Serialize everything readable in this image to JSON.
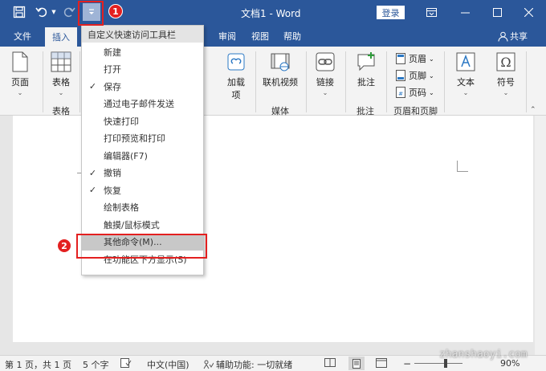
{
  "titlebar": {
    "title": "文档1 - Word",
    "login": "登录",
    "accent": "#2b579a"
  },
  "tabs": {
    "file": "文件",
    "insert": "插入",
    "review": "审阅",
    "view": "视图",
    "help": "帮助",
    "share": "共享"
  },
  "ribbon": {
    "page": "页面",
    "table": "表格",
    "table_group": "表格",
    "addins": "加载\n项",
    "addins_l1": "加载",
    "addins_l2": "项",
    "online_video": "联机视频",
    "media_group": "媒体",
    "link": "链接",
    "comment": "批注",
    "comment_group": "批注",
    "header": "页眉",
    "footer": "页脚",
    "page_number": "页码",
    "header_footer_group": "页眉和页脚",
    "text": "文本",
    "symbol": "符号"
  },
  "menu": {
    "title": "自定义快速访问工具栏",
    "items": [
      {
        "label": "新建",
        "checked": false
      },
      {
        "label": "打开",
        "checked": false
      },
      {
        "label": "保存",
        "checked": true
      },
      {
        "label": "通过电子邮件发送",
        "checked": false
      },
      {
        "label": "快速打印",
        "checked": false
      },
      {
        "label": "打印预览和打印",
        "checked": false
      },
      {
        "label": "编辑器(F7)",
        "checked": false
      },
      {
        "label": "撤销",
        "checked": true
      },
      {
        "label": "恢复",
        "checked": true
      },
      {
        "label": "绘制表格",
        "checked": false
      },
      {
        "label": "触摸/鼠标模式",
        "checked": false
      },
      {
        "label": "其他命令(M)...",
        "checked": false
      },
      {
        "label": "在功能区下方显示(S)",
        "checked": false
      }
    ],
    "check_mark": "✓"
  },
  "annotations": {
    "badge1": "1",
    "badge2": "2",
    "color": "#e32020"
  },
  "statusbar": {
    "page": "第 1 页，共 1 页",
    "words": "5 个字",
    "language": "中文(中国)",
    "accessibility": "辅助功能: 一切就绪",
    "zoom": "90%"
  },
  "watermark": "zhanshaoyi.com"
}
